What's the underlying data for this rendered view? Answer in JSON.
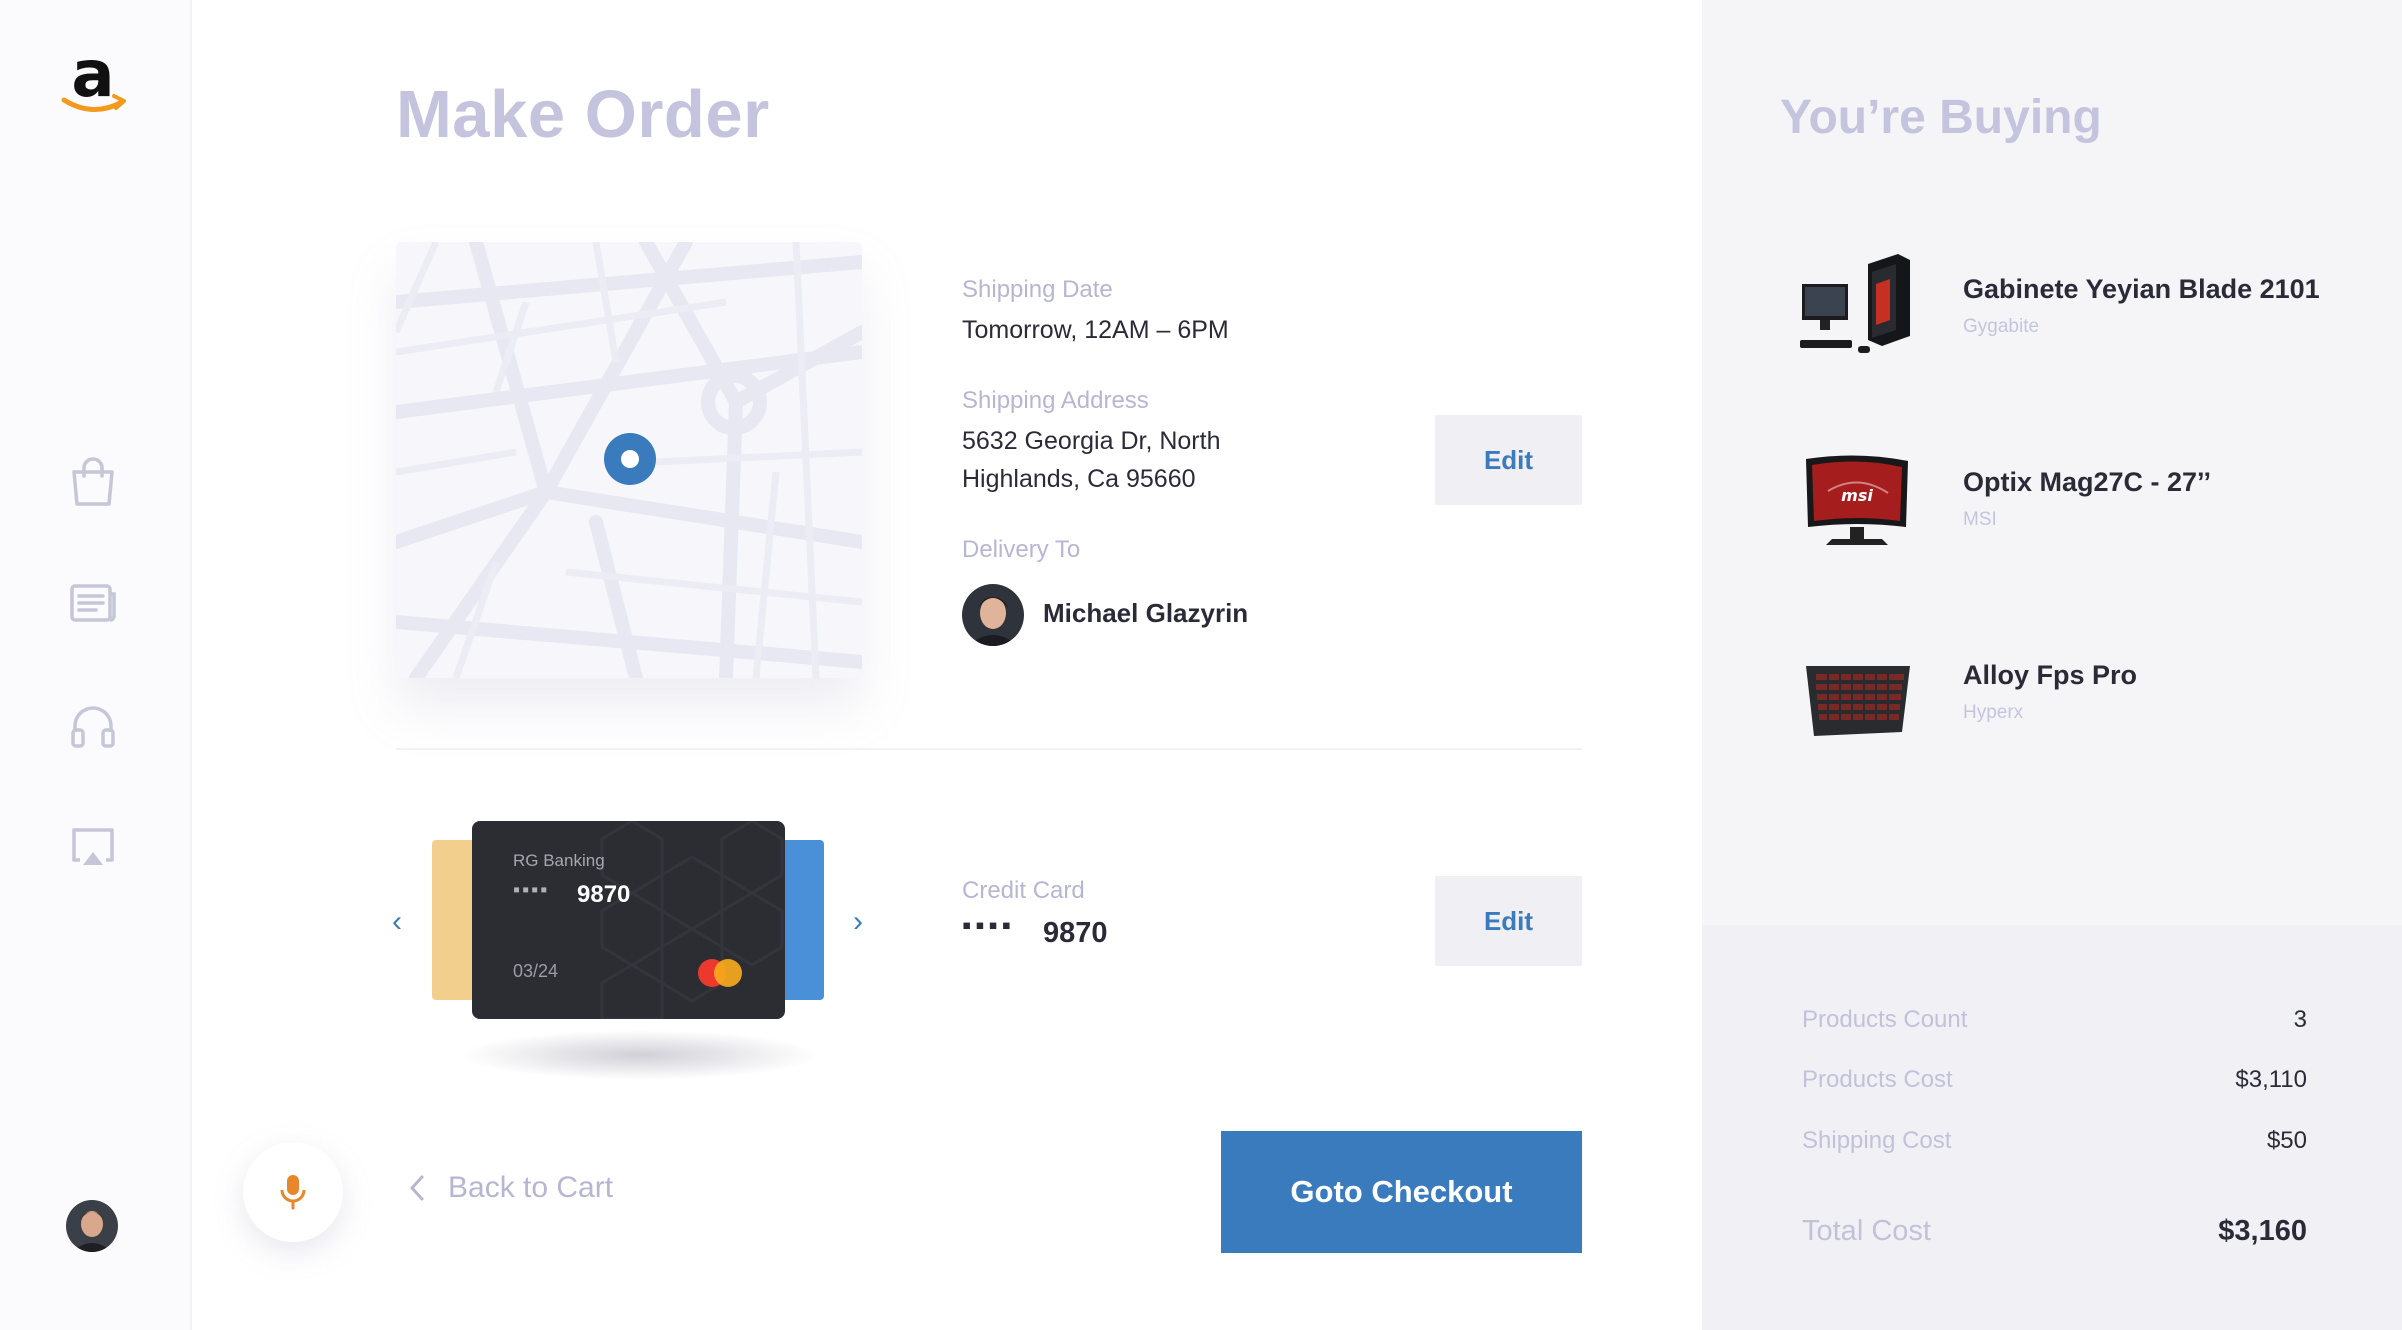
{
  "sidebar": {
    "logo_letter": "a",
    "items": [
      {
        "icon": "shopping-bag-icon"
      },
      {
        "icon": "news-icon"
      },
      {
        "icon": "headphones-icon"
      },
      {
        "icon": "airplay-icon"
      }
    ]
  },
  "main": {
    "title": "Make Order",
    "shipping": {
      "date_label": "Shipping Date",
      "date_value": "Tomorrow, 12AM – 6PM",
      "address_label": "Shipping Address",
      "address_line1": "5632 Georgia Dr, North",
      "address_line2": "Highlands, Ca 95660",
      "delivery_label": "Delivery To",
      "recipient": "Michael Glazyrin",
      "edit_label": "Edit"
    },
    "payment": {
      "card_bank": "RG Banking",
      "card_dots": "▪▪▪▪",
      "card_last4": "9870",
      "card_expiry": "03/24",
      "label": "Credit Card",
      "masked": "▪▪▪▪",
      "last4": "9870",
      "edit_label": "Edit"
    },
    "back_label": "Back to Cart",
    "checkout_label": "Goto Checkout"
  },
  "cart": {
    "title": "You’re Buying",
    "products": [
      {
        "name": "Gabinete Yeyian Blade 2101",
        "brand": "Gygabite"
      },
      {
        "name": "Optix Mag27C - 27’’",
        "brand": "MSI"
      },
      {
        "name": "Alloy Fps Pro",
        "brand": "Hyperx"
      }
    ],
    "summary": {
      "count_label": "Products Count",
      "count_value": "3",
      "cost_label": "Products Cost",
      "cost_value": "$3,110",
      "shipping_label": "Shipping Cost",
      "shipping_value": "$50",
      "total_label": "Total Cost",
      "total_value": "$3,160"
    }
  },
  "colors": {
    "accent": "#3a7bbd",
    "heading_muted": "#c5c4de",
    "card_dark": "#2c2d33",
    "mic": "#e8862a"
  }
}
